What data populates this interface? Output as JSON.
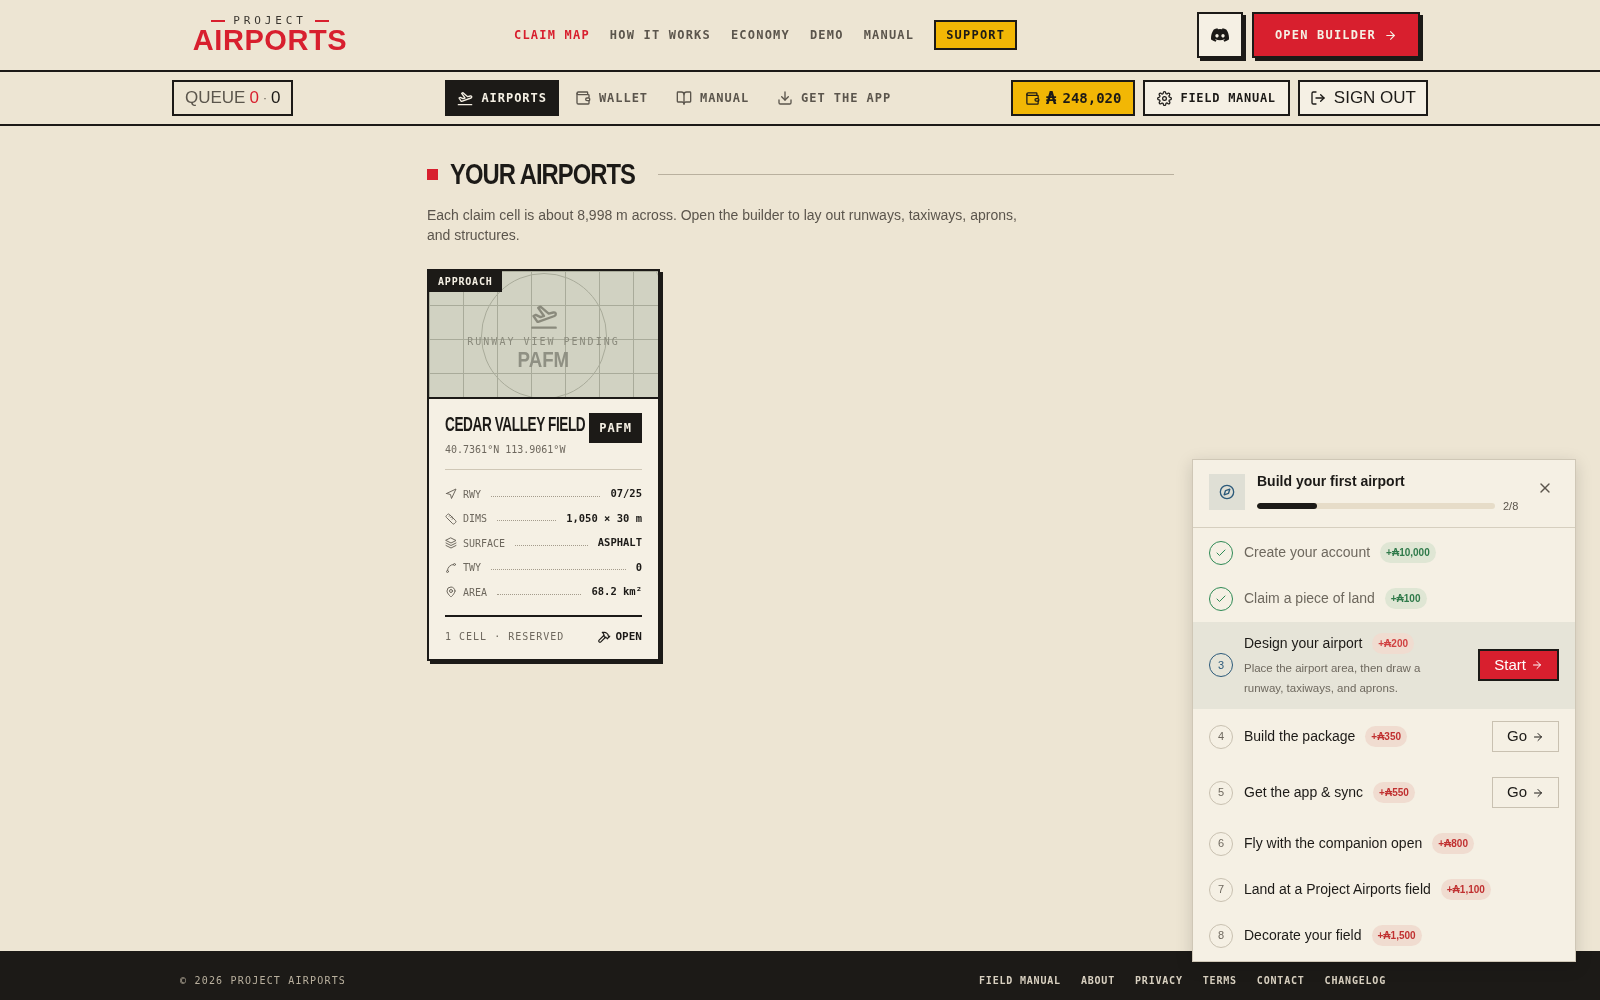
{
  "logo": {
    "top": "PROJECT",
    "main": "AIRPORTS"
  },
  "nav": [
    {
      "label": "CLAIM MAP",
      "selected": true
    },
    {
      "label": "HOW IT WORKS",
      "selected": false
    },
    {
      "label": "ECONOMY",
      "selected": false
    },
    {
      "label": "DEMO",
      "selected": false
    },
    {
      "label": "MANUAL",
      "selected": false
    }
  ],
  "support": "SUPPORT",
  "open_builder": "OPEN BUILDER",
  "queue": {
    "label": "QUEUE",
    "a": "0",
    "sep": "·",
    "b": "0"
  },
  "tabs": [
    {
      "label": "AIRPORTS",
      "selected": true
    },
    {
      "label": "WALLET",
      "selected": false
    },
    {
      "label": "MANUAL",
      "selected": false
    },
    {
      "label": "GET THE APP",
      "selected": false
    }
  ],
  "balance": {
    "symbol": "₳",
    "amount": "248,020"
  },
  "field_manual": "FIELD MANUAL",
  "sign_out": "SIGN OUT",
  "section": {
    "title": "YOUR AIRPORTS",
    "intro": "Each claim cell is about 8,998 m across. Open the builder to lay out runways, taxiways, aprons, and structures."
  },
  "airports": [
    {
      "tag": "APPROACH",
      "pending": "RUNWAY VIEW PENDING",
      "art_code": "PAFM",
      "name": "CEDAR VALLEY FIELD",
      "code": "PAFM",
      "coords": "40.7361°N 113.9061°W",
      "stats": [
        {
          "label": "RWY",
          "value": "07/25"
        },
        {
          "label": "DIMS",
          "value": "1,050 × 30 m"
        },
        {
          "label": "SURFACE",
          "value": "ASPHALT"
        },
        {
          "label": "TWY",
          "value": "0"
        },
        {
          "label": "AREA",
          "value": "68.2 km²"
        }
      ],
      "footer": "1 CELL · RESERVED",
      "open": "OPEN"
    }
  ],
  "onboarding": {
    "title": "Build your first airport",
    "level": 0.25,
    "count": "2/8",
    "steps": [
      {
        "done": true,
        "current": false,
        "title": "Create your account",
        "reward": "+₳10,000"
      },
      {
        "done": true,
        "current": false,
        "title": "Claim a piece of land",
        "reward": "+₳100"
      },
      {
        "number": "3",
        "done": false,
        "current": true,
        "title": "Design your airport",
        "reward": "+₳200",
        "description": "Place the airport area, then draw a runway, taxiways, and aprons.",
        "action": "Start"
      },
      {
        "number": "4",
        "done": false,
        "current": false,
        "title": "Build the package",
        "reward": "+₳350",
        "action": "Go"
      },
      {
        "number": "5",
        "done": false,
        "current": false,
        "title": "Get the app & sync",
        "reward": "+₳550",
        "action": "Go"
      },
      {
        "number": "6",
        "done": false,
        "current": false,
        "title": "Fly with the companion open",
        "reward": "+₳800"
      },
      {
        "number": "7",
        "done": false,
        "current": false,
        "title": "Land at a Project Airports field",
        "reward": "+₳1,100"
      },
      {
        "number": "8",
        "done": false,
        "current": false,
        "title": "Decorate your field",
        "reward": "+₳1,500"
      }
    ]
  },
  "footer": {
    "copyright": "© 2026 PROJECT AIRPORTS",
    "links": [
      "FIELD MANUAL",
      "ABOUT",
      "PRIVACY",
      "TERMS",
      "CONTACT",
      "CHANGELOG"
    ]
  }
}
